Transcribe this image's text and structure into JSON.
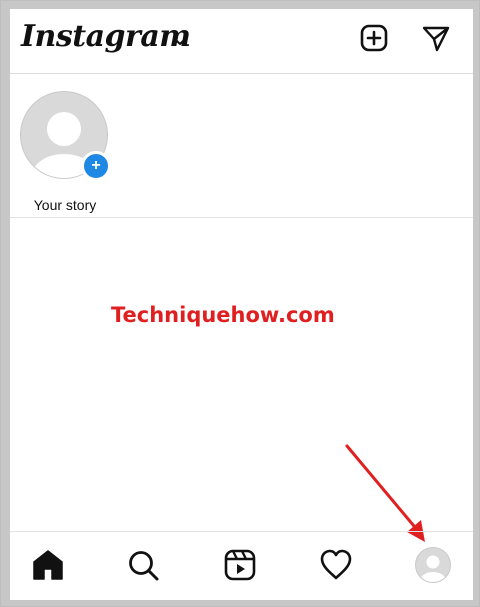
{
  "app": {
    "title": "Instagram"
  },
  "stories": {
    "items": [
      {
        "label": "Your story"
      }
    ]
  },
  "feed": {
    "watermark": "Techniquehow.com"
  },
  "colors": {
    "accent": "#1e88e5",
    "watermark": "#e02020",
    "avatar_placeholder": "#d9d9d9"
  },
  "icons": {
    "logo_dropdown": "chevron-down-icon",
    "new_post": "plus-square-icon",
    "direct": "paper-plane-icon",
    "home": "home-icon",
    "search": "search-icon",
    "reels": "reels-icon",
    "activity": "heart-icon",
    "profile": "avatar"
  }
}
